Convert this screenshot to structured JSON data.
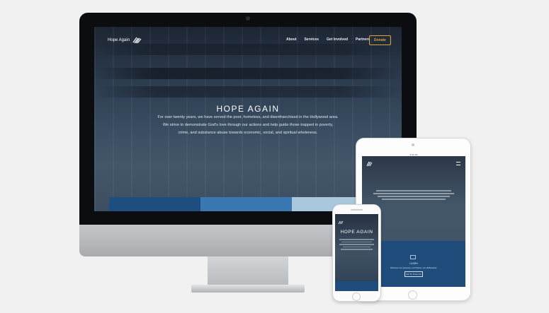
{
  "desktop": {
    "brand": "Hope Again",
    "nav": [
      "About",
      "Services",
      "Get Involved",
      "Partners"
    ],
    "donate_label": "Donate",
    "hero_title": "HOPE AGAIN",
    "hero_lines": [
      "For over twenty years, we have served the poor, homeless, and disenfranchised in the Hollywood area.",
      "We strive to demonstrate God's love through our actions and help guide those trapped in poverty,",
      "crime, and substance abuse towards economic, social, and spiritual wholeness."
    ],
    "tile_colors": [
      "#1e4e80",
      "#3a78b1",
      "#a9c8de"
    ]
  },
  "tablet": {
    "status_time": "9:41 AM",
    "card_heading": "LEARN",
    "card_text": "Discover our purpose, our history, our philosophy.",
    "card_button": "Get To Know Us",
    "card_color": "#1f4c7b"
  },
  "phone": {
    "hero_title": "HOPE AGAIN",
    "card_color": "#1f4c7b"
  },
  "colors": {
    "accent": "#d9a340",
    "bezel": "#0c0d10",
    "background": "#f1f1f2"
  }
}
